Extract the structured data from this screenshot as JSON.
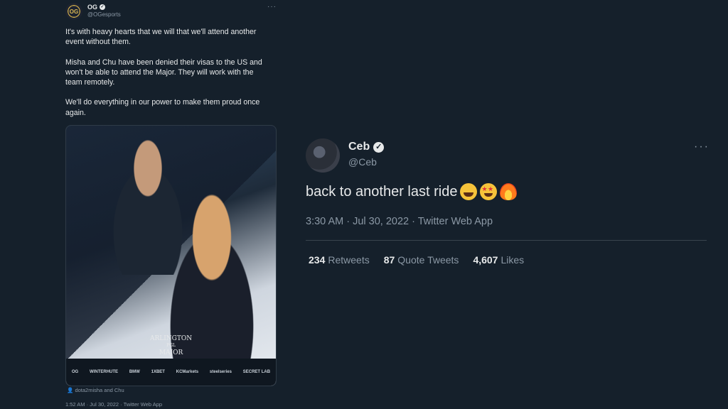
{
  "left_tweet": {
    "name": "OG",
    "handle": "@OGesports",
    "paragraphs": [
      "It's with heavy hearts that we will that we'll attend another event without them.",
      "Misha and Chu have been denied their visas to the US and won't be able to attend the Major. They will work with the team remotely.",
      "We'll do everything in our power to make them proud once again."
    ],
    "media_logo_line1": "ARLINGTON",
    "media_logo_line2": "PGL",
    "media_logo_line3": "MAJOR",
    "media_sponsors": [
      "OG",
      "WINTERHUTE",
      "BMW",
      "1XBET",
      "KCMarkets",
      "steelseries",
      "SECRET LAB"
    ],
    "tagged": "dota2misha and Chu",
    "meta": "1:52 AM · Jul 30, 2022 · Twitter Web App",
    "more": "···",
    "avatar_label": "OG"
  },
  "right_tweet": {
    "name": "Ceb",
    "handle": "@Ceb",
    "text": "back to another last ride",
    "emojis": [
      "face-with-tears-of-joy",
      "star-struck",
      "fire"
    ],
    "meta": "3:30 AM · Jul 30, 2022 · Twitter Web App",
    "more": "···",
    "stats": [
      {
        "count": "234",
        "label": "Retweets"
      },
      {
        "count": "87",
        "label": "Quote Tweets"
      },
      {
        "count": "4,607",
        "label": "Likes"
      }
    ]
  },
  "colors": {
    "background": "#15202b",
    "text": "#e7e9ea",
    "muted": "#8b98a5",
    "divider": "#38444d"
  }
}
